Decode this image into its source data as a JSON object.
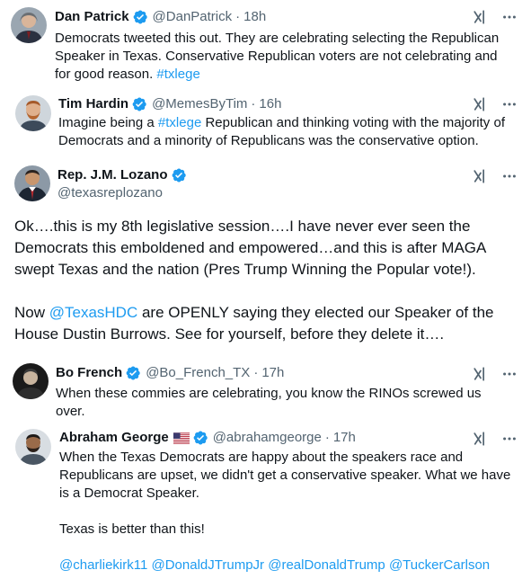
{
  "tweets": [
    {
      "name": "Dan Patrick",
      "handle": "@DanPatrick",
      "time": "18h",
      "body": [
        "Democrats tweeted this out. They are celebrating selecting the Republican",
        "Speaker in Texas. Conservative Republican voters are not celebrating and",
        "for good reason. "
      ],
      "hashtag": "#txlege"
    },
    {
      "name": "Tim Hardin",
      "handle": "@MemesByTim",
      "time": "16h",
      "body_prefix": "Imagine being a ",
      "hashtag": "#txlege",
      "body_suffix": " Republican and thinking voting with the majority of",
      "body_line2": "Democrats and a minority of Republicans was the conservative option."
    },
    {
      "name": "Rep. J.M. Lozano",
      "handle": "@texasreplozano",
      "p1": [
        "Ok….this is my 8th legislative session….I have never ever seen the",
        "Democrats this emboldened and empowered…and this is after MAGA",
        "swept Texas and the nation (Pres Trump Winning the Popular vote!)."
      ],
      "p2_prefix": "Now ",
      "mention": "@TexasHDC",
      "p2_suffix": " are OPENLY saying they elected our Speaker of the",
      "p2_line2": "House Dustin Burrows.  See for yourself, before they delete it…."
    },
    {
      "name": "Bo French",
      "handle": "@Bo_French_TX",
      "time": "17h",
      "body": [
        "When these commies are celebrating, you know the RINOs screwed us",
        "over."
      ]
    },
    {
      "name": "Abraham George",
      "flag": "us-flag",
      "handle": "@abrahamgeorge",
      "time": "17h",
      "body": [
        "When the Texas Democrats are happy about the speakers race and",
        "Republicans are upset, we didn't get a conservative speaker. What we have",
        "is a Democrat Speaker."
      ],
      "line2": "Texas is better than this!",
      "mentions": [
        "@charliekirk11",
        "@DonaldJTrumpJr",
        "@realDonaldTrump",
        "@TuckerCarlson"
      ]
    }
  ],
  "separator": "·",
  "icons": {
    "verified": "verified-badge-icon",
    "grok": "grok-icon",
    "more": "more-icon"
  },
  "colors": {
    "link": "#1d9bf0",
    "verified": "#1d9bf0",
    "muted": "#536471"
  }
}
